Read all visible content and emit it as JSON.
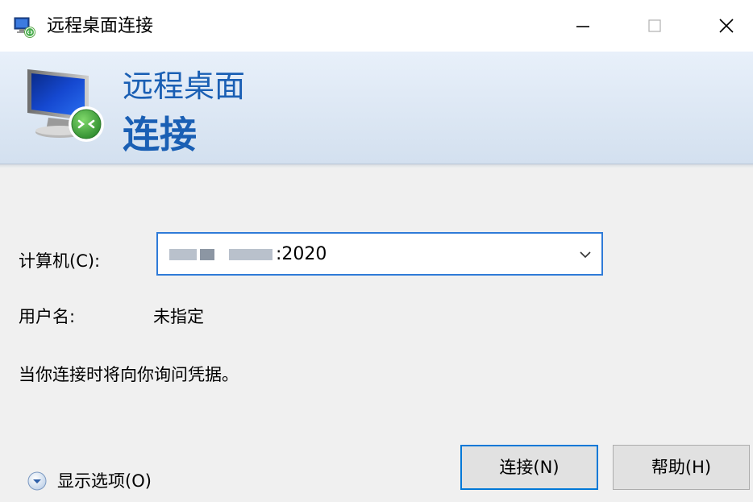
{
  "window": {
    "title": "远程桌面连接",
    "controls": {
      "minimize": "—",
      "maximize": "☐",
      "close": "✕"
    }
  },
  "banner": {
    "line1": "远程桌面",
    "line2": "连接",
    "icon": "remote-desktop-monitor-icon"
  },
  "form": {
    "computer_label": "计算机(C):",
    "computer_value_visible": ":2020",
    "computer_value_redacted": true,
    "username_label": "用户名:",
    "username_value": "未指定",
    "note": "当你连接时将向你询问凭据。"
  },
  "footer": {
    "show_options": "显示选项(O)",
    "connect_button": "连接(N)",
    "help_button": "帮助(H)"
  },
  "colors": {
    "accent": "#1a5fb4",
    "focus_border": "#0078d7",
    "content_bg": "#f0f0f0",
    "button_bg": "#e1e1e1"
  }
}
